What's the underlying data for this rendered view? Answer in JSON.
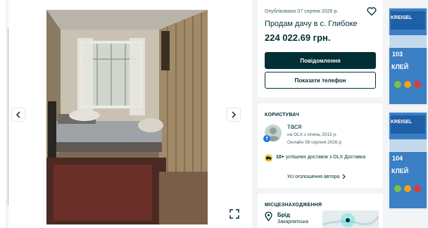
{
  "listing": {
    "posted": "Опубліковано 07 серпня 2026 р.",
    "title": "Продам дачу в с. Глибоке",
    "price": "224 022.69 грн."
  },
  "actions": {
    "message_label": "Повідомлення",
    "phone_label": "Показати телефон"
  },
  "user": {
    "section_title": "КОРИСТУВАЧ",
    "name": "тася",
    "since": "на OLX з січень 2013 р.",
    "online": "Онлайн 08 серпня 2026 р.",
    "deliveries_count": "10+",
    "deliveries_text": "успішних доставок з OLX Доставка",
    "all_ads_label": "Усі оголошення автора"
  },
  "location": {
    "section_title": "МІСЦЕЗНАХОДЖЕННЯ",
    "city": "Брід",
    "region": "Закарпатська"
  },
  "banner": {
    "brand": "KREISEL",
    "product_top": "103",
    "product_bottom": "104",
    "word": "КЛЕЙ"
  },
  "icons": {
    "prev": "chevron-left-icon",
    "next": "chevron-right-icon",
    "expand": "expand-icon",
    "favorite": "heart-icon",
    "delivery": "truck-icon",
    "location": "location-pin-icon"
  },
  "colors": {
    "primary": "#002f34",
    "muted": "#406367",
    "background": "#f2f4f5",
    "card": "#ffffff",
    "delivery_badge": "#ffce32",
    "banner": "#3b7fc4"
  }
}
